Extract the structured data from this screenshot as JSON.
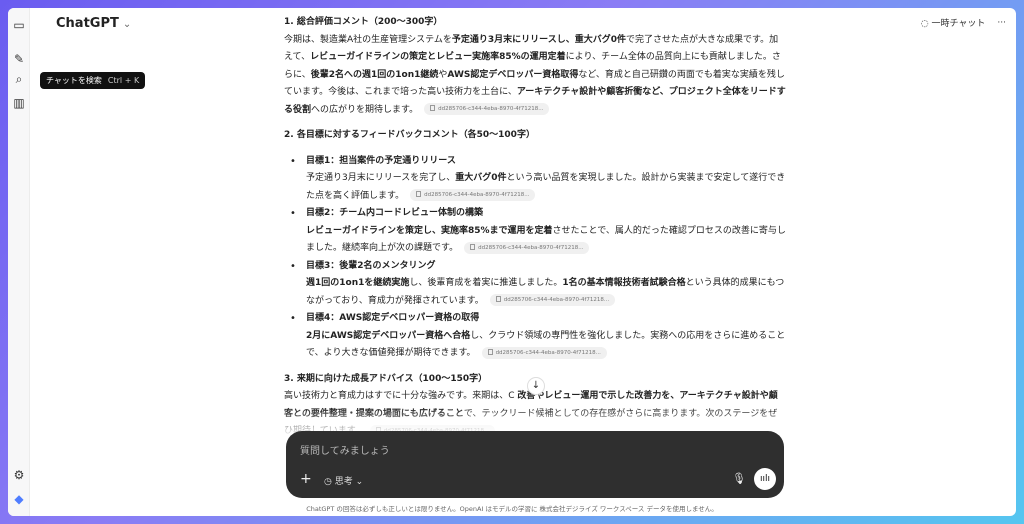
{
  "app": {
    "title": "ChatGPT"
  },
  "tooltip": {
    "label": "チャットを検索",
    "shortcut": "Ctrl + K"
  },
  "topbar": {
    "temp_chat": "一時チャット",
    "more": "···"
  },
  "section1": {
    "heading": "1. 総合評価コメント（200～300字）",
    "body_html": "今期は、製造業A社の生産管理システムを<b>予定通り3月末にリリースし、重大バグ0件</b>で完了させた点が大きな成果です。加えて、<b>レビューガイドラインの策定とレビュー実施率85%の運用定着</b>により、チーム全体の品質向上にも貢献しました。さらに、<b>後輩2名への週1回の1on1継続</b>や<b>AWS認定デベロッパー資格取得</b>など、育成と自己研鑽の両面でも着実な実績を残しています。今後は、これまで培った高い技術力を土台に、<b>アーキテクチャ設計や顧客折衝など、プロジェクト全体をリードする役割</b>への広がりを期待します。"
  },
  "source_label": "dd285706-c344-4eba-8970-4f71218...",
  "section2": {
    "heading": "2. 各目標に対するフィードバックコメント（各50～100字）",
    "goals": [
      {
        "title": "目標1：担当案件の予定通りリリース",
        "body_html": "予定通り3月末にリリースを完了し、<b>重大バグ0件</b>という高い品質を実現しました。設計から実装まで安定して遂行できた点を高く評価します。"
      },
      {
        "title": "目標2：チーム内コードレビュー体制の構築",
        "body_html": "<b>レビューガイドラインを策定し、実施率85%まで運用を定着</b>させたことで、属人的だった確認プロセスの改善に寄与しました。継続率向上が次の課題です。"
      },
      {
        "title": "目標3：後輩2名のメンタリング",
        "body_html": "<b>週1回の1on1を継続実施</b>し、後輩育成を着実に推進しました。<b>1名の基本情報技術者試験合格</b>という具体的成果にもつながっており、育成力が発揮されています。"
      },
      {
        "title": "目標4：AWS認定デベロッパー資格の取得",
        "body_html": "<b>2月にAWS認定デベロッパー資格へ合格</b>し、クラウド領域の専門性を強化しました。実務への応用をさらに進めることで、より大きな価値発揮が期待できます。"
      }
    ]
  },
  "section3": {
    "heading": "3. 来期に向けた成長アドバイス（100～150字）",
    "body_html": "高い技術力と育成力はすでに十分な強みです。来期は、C <b>改善やレビュー運用で示した改善力を、アーキテクチャ設計や顧客との要件整理・提案の場面にも広げること</b>で、テックリード候補としての存在感がさらに高まります。次のステージをぜひ期待しています。"
  },
  "composer": {
    "placeholder": "質問してみましょう",
    "mode_label": "思考"
  },
  "footer": {
    "text": "ChatGPT の回答は必ずしも正しいとは限りません。OpenAI はモデルの学習に 株式会社デジライズ ワークスペース データを使用しません。"
  }
}
